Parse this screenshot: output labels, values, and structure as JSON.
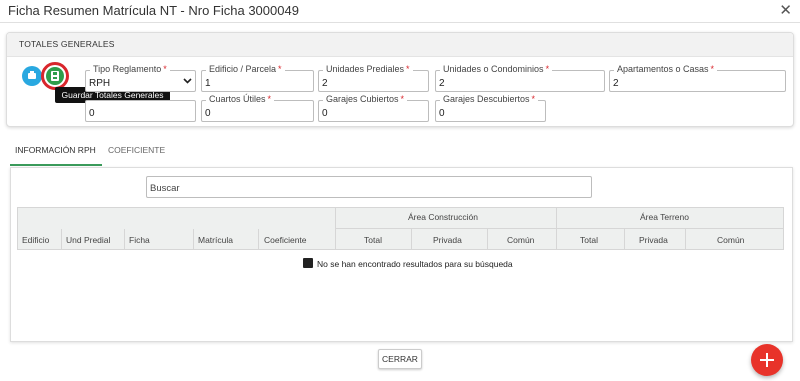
{
  "dialog": {
    "title": "Ficha Resumen Matrícula NT - Nro Ficha 3000049",
    "close_glyph": "✕"
  },
  "totales": {
    "header": "TOTALES GENERALES",
    "tooltip": "Guardar Totales Generales",
    "fields": {
      "tipo_reglamento": {
        "label": "Tipo Reglamento",
        "value": "RPH"
      },
      "edificio_parcela": {
        "label": "Edificio / Parcela",
        "value": "1"
      },
      "unidades_prediales": {
        "label": "Unidades Prediales",
        "value": "2"
      },
      "unidades_condominios": {
        "label": "Unidades o Condominios",
        "value": "2"
      },
      "apartamentos_casas": {
        "label": "Apartamentos o Casas",
        "value": "2"
      },
      "campo_oculto": {
        "value": "0"
      },
      "cuartos_utiles": {
        "label": "Cuartos Útiles",
        "value": "0"
      },
      "garajes_cubiertos": {
        "label": "Garajes Cubiertos",
        "value": "0"
      },
      "garajes_descubiertos": {
        "label": "Garajes Descubiertos",
        "value": "0"
      }
    },
    "required_mark": "*"
  },
  "tabs": {
    "rph": "INFORMACIÓN RPH",
    "coeficiente": "COEFICIENTE"
  },
  "table": {
    "search_placeholder": "Buscar",
    "group_headers": {
      "construccion": "Área Construcción",
      "terreno": "Área Terreno"
    },
    "columns": [
      "Edificio",
      "Und Predial",
      "Ficha",
      "Matrícula",
      "Coeficiente",
      "Total",
      "Privada",
      "Común",
      "Total",
      "Privada",
      "Común"
    ],
    "empty_message": "No se han encontrado resultados para su búsqueda"
  },
  "footer": {
    "close_button": "CERRAR"
  },
  "colors": {
    "accent_green": "#3b9b5b",
    "danger_red": "#e8332a",
    "info_blue": "#29a8e0"
  },
  "icons": {
    "info": "info-icon",
    "save": "save-icon",
    "empty": "thumbs-down-icon",
    "add": "plus-icon"
  }
}
